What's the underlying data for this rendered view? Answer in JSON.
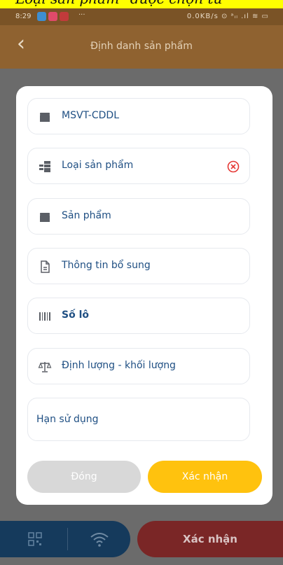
{
  "caption": {
    "text": "Loại sản phẩm\" được chọn từ"
  },
  "status_bar": {
    "time": "8:29",
    "dots": "···",
    "right_text": "0.0KB/s ⊙ ᵃᵢₗ .ıl ≋ ▭"
  },
  "app_bar": {
    "title": "Định danh sản phẩm"
  },
  "modal": {
    "fields": [
      {
        "label": "MSVT-CDDL",
        "icon": "box-icon"
      },
      {
        "label": "Loại sản phẩm",
        "icon": "category-icon",
        "has_clear": true
      },
      {
        "label": "Sản phẩm",
        "icon": "box-icon"
      },
      {
        "label": "Thông tin bổ sung",
        "icon": "document-icon"
      },
      {
        "label": "Số lô",
        "icon": "barcode-icon"
      },
      {
        "label": "Định lượng - khối lượng",
        "icon": "scale-icon"
      },
      {
        "label": "Hạn sử dụng"
      }
    ],
    "close_label": "Đóng",
    "confirm_label": "Xác nhận"
  },
  "bottom_bar": {
    "confirm_label": "Xác nhận"
  },
  "colors": {
    "label_blue": "#1f4f83",
    "confirm_yellow": "#ffc20e",
    "close_grey": "#d8d8d8",
    "clear_red": "#e53935"
  }
}
